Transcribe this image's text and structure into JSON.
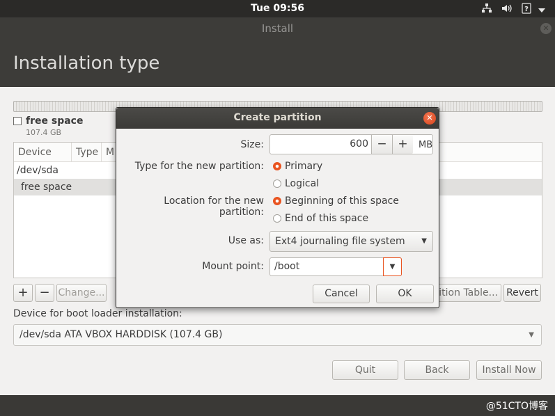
{
  "topbar": {
    "clock": "Tue 09:56",
    "icons": [
      "network-icon",
      "volume-icon",
      "help-icon",
      "menu-arrow-icon"
    ]
  },
  "window": {
    "title": "Install",
    "page_title": "Installation type"
  },
  "disk": {
    "legend_name": "free space",
    "legend_size": "107.4 GB"
  },
  "table": {
    "headers": [
      "Device",
      "Type",
      "M"
    ],
    "rows": [
      {
        "device": "/dev/sda"
      },
      {
        "device": "free space"
      }
    ]
  },
  "table_buttons": {
    "add": "+",
    "remove": "−",
    "change": "Change...",
    "new_table": "ition Table...",
    "revert": "Revert"
  },
  "bootloader": {
    "label": "Device for boot loader installation:",
    "value": "/dev/sda ATA VBOX HARDDISK (107.4 GB)"
  },
  "nav": {
    "quit": "Quit",
    "back": "Back",
    "install": "Install Now"
  },
  "watermark": "@51CTO博客",
  "dialog": {
    "title": "Create partition",
    "size_label": "Size:",
    "size_value": "600",
    "minus": "−",
    "plus": "+",
    "size_unit": "MB",
    "type_label": "Type for the new partition:",
    "type_primary": "Primary",
    "type_logical": "Logical",
    "location_label": "Location for the new partition:",
    "location_begin": "Beginning of this space",
    "location_end": "End of this space",
    "useas_label": "Use as:",
    "useas_value": "Ext4 journaling file system",
    "mount_label": "Mount point:",
    "mount_value": "/boot",
    "cancel": "Cancel",
    "ok": "OK"
  },
  "colors": {
    "accent": "#e95420",
    "header_bg": "#3d3c39",
    "panel_bg": "#2b2a28",
    "window_bg": "#f2f1f0"
  }
}
